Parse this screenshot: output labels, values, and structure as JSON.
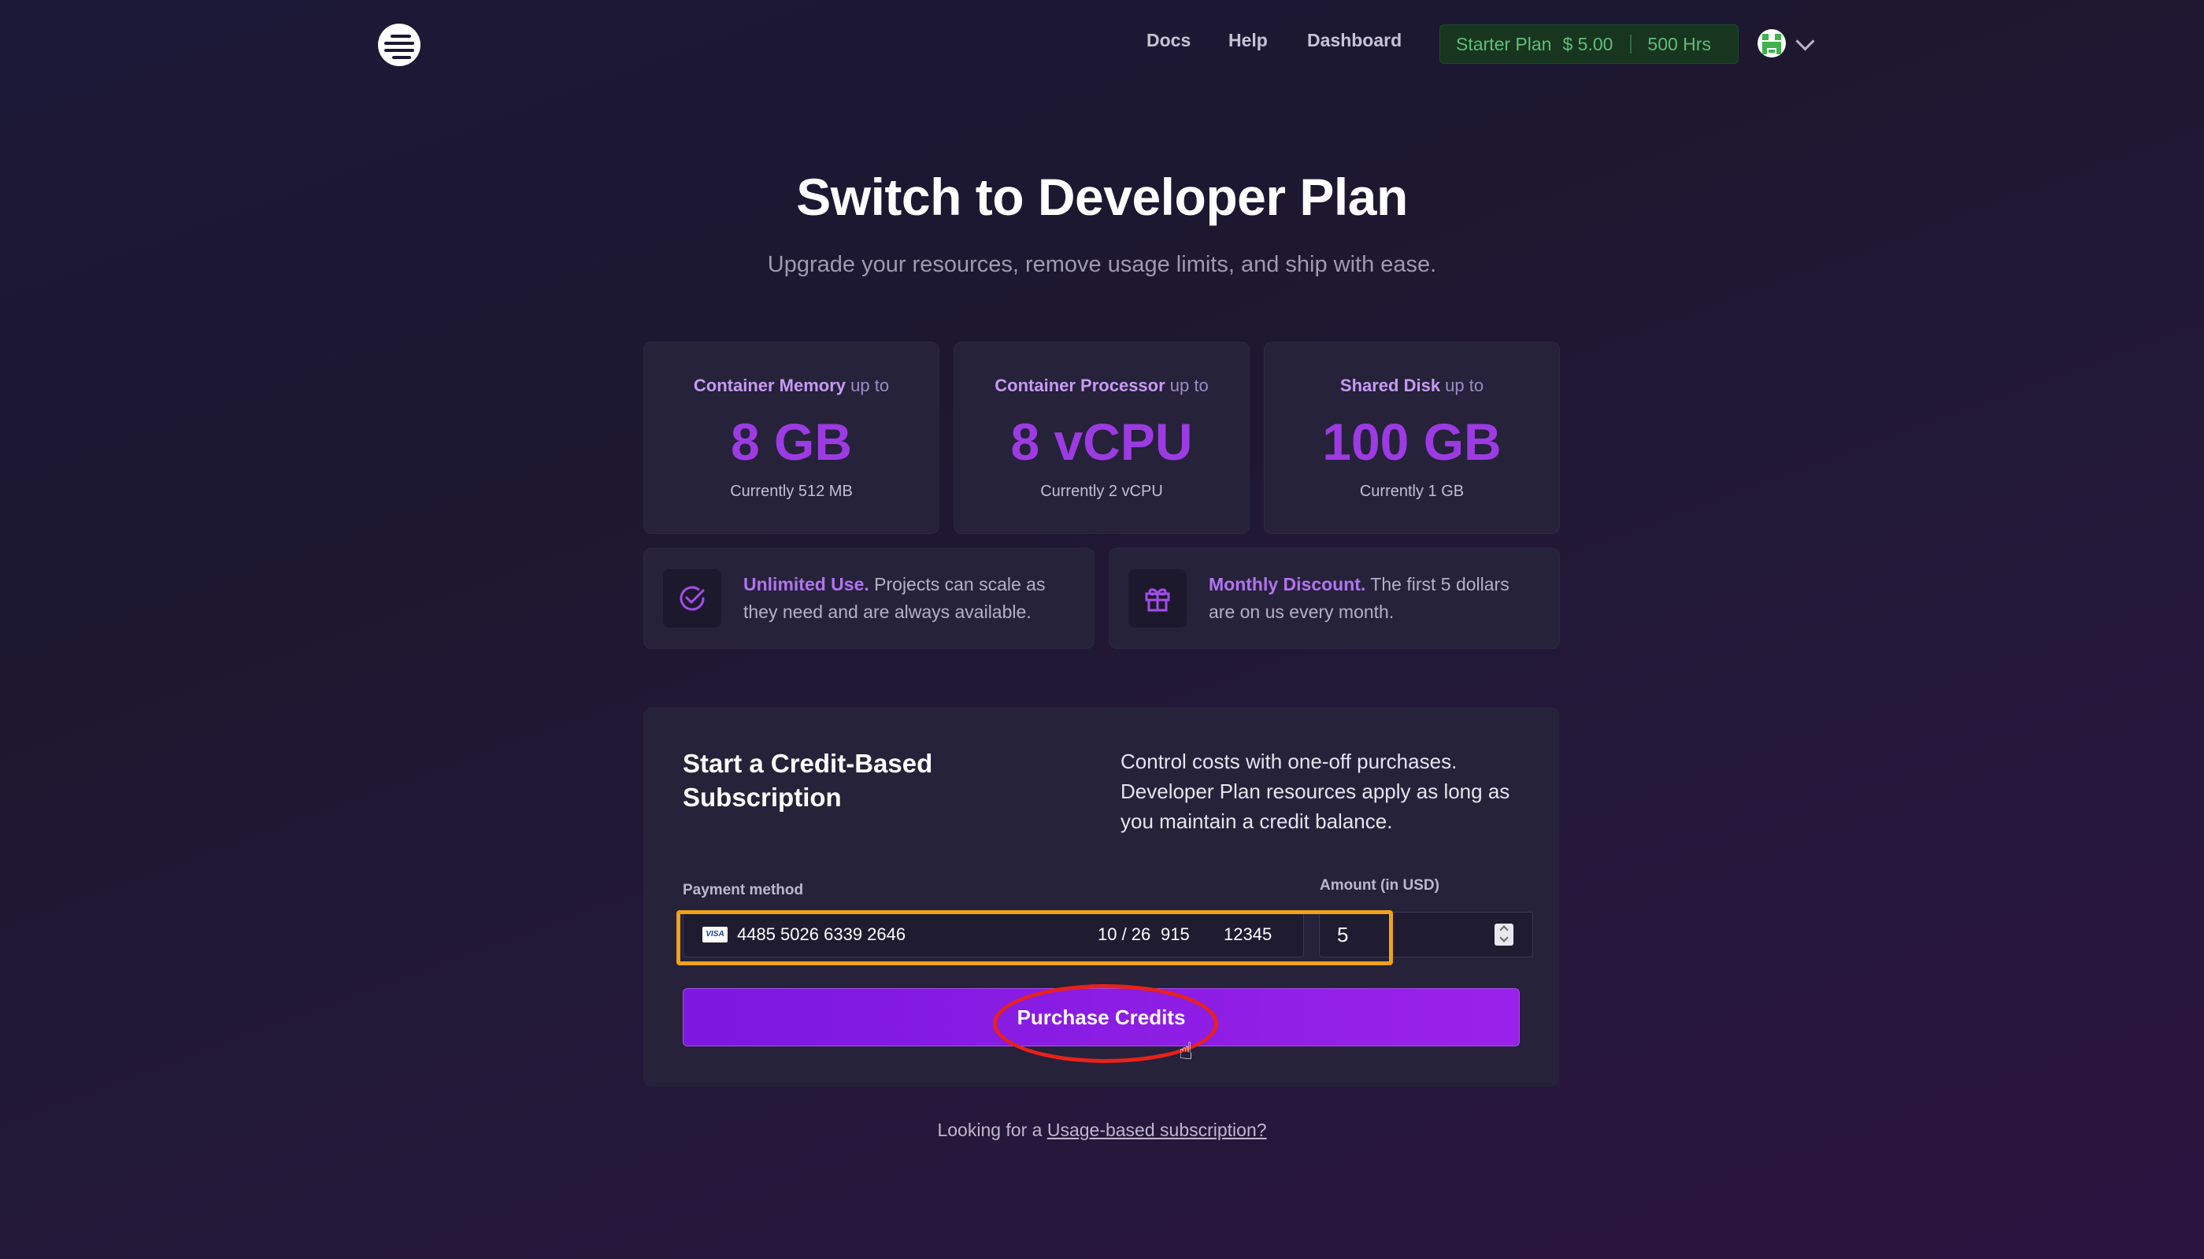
{
  "nav": {
    "links": [
      "Docs",
      "Help",
      "Dashboard"
    ],
    "plan_name": "Starter Plan",
    "plan_balance": "$ 5.00",
    "plan_hours": "500 Hrs"
  },
  "hero": {
    "title": "Switch to Developer Plan",
    "subtitle": "Upgrade your resources, remove usage limits, and ship with ease."
  },
  "stats": [
    {
      "label_strong": "Container Memory",
      "label_rest": " up to",
      "value": "8 GB",
      "current": "Currently 512 MB"
    },
    {
      "label_strong": "Container Processor",
      "label_rest": " up to",
      "value": "8 vCPU",
      "current": "Currently 2 vCPU"
    },
    {
      "label_strong": "Shared Disk",
      "label_rest": " up to",
      "value": "100 GB",
      "current": "Currently 1 GB"
    }
  ],
  "features": [
    {
      "strong": "Unlimited Use.",
      "text": " Projects can scale as they need and are always available."
    },
    {
      "strong": "Monthly Discount.",
      "text": " The first 5 dollars are on us every month."
    }
  ],
  "subscription": {
    "title": "Start a Credit-Based Subscription",
    "description": "Control costs with one-off purchases. Developer Plan resources apply as long as you maintain a credit balance.",
    "payment_label": "Payment method",
    "amount_label": "Amount (in USD)",
    "card_brand": "VISA",
    "card_number": "4485 5026 6339 2646",
    "card_expiry": "10 / 26",
    "card_cvc": "915",
    "card_zip": "12345",
    "amount": "5",
    "button_label": "Purchase Credits"
  },
  "footer": {
    "prefix": "Looking for a ",
    "link": "Usage-based subscription?"
  },
  "colors": {
    "accent": "#9d3be3",
    "button": "#8b1fe4",
    "highlight_box": "#f0a21a",
    "annotation_circle": "#e8221a",
    "plan_pill_text": "#5fbf78"
  }
}
